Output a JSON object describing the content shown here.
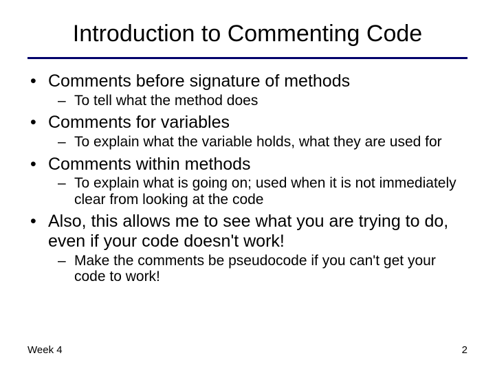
{
  "title": "Introduction to Commenting Code",
  "bullets": [
    {
      "text": "Comments before signature of methods",
      "sub": [
        "To tell what the method does"
      ]
    },
    {
      "text": "Comments for variables",
      "sub": [
        "To explain what the variable holds, what they are used for"
      ]
    },
    {
      "text": "Comments within methods",
      "sub": [
        "To explain what is going on; used when it is not immediately clear from looking at the code"
      ]
    },
    {
      "text": "Also, this allows me to see what you are trying to do, even if your code doesn't work!",
      "sub": [
        "Make the comments be pseudocode if you can't get your code to work!"
      ]
    }
  ],
  "footer": {
    "left": "Week 4",
    "right": "2"
  }
}
